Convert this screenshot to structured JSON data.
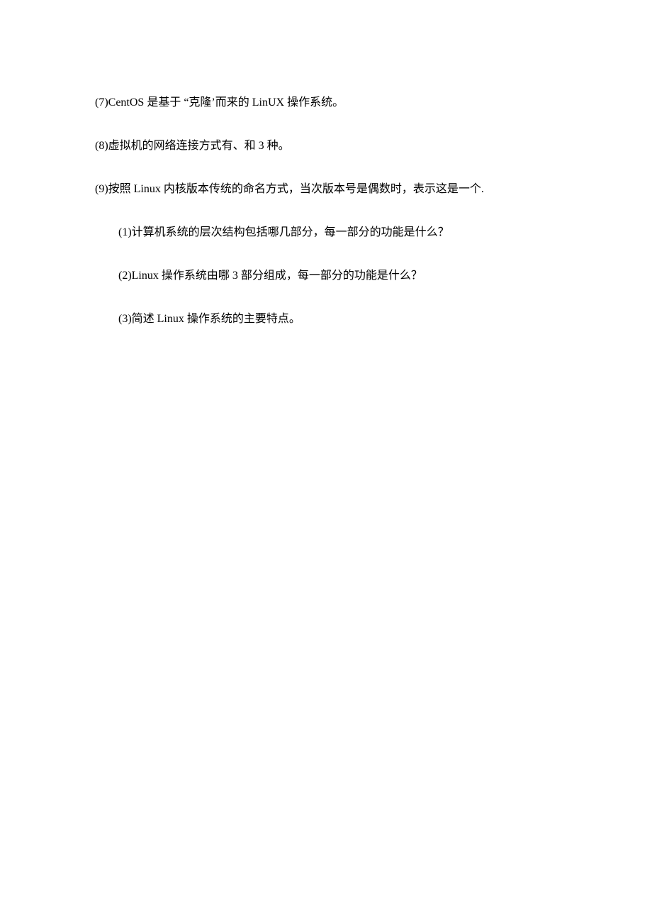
{
  "lines": {
    "q7": "(7)CentOS 是基于 “克隆’而来的 LinUX 操作系统。",
    "q8": "(8)虚拟机的网络连接方式有、和 3 种。",
    "q9": "(9)按照 Linux 内核版本传统的命名方式，当次版本号是偶数时，表示这是一个.",
    "sub1": "(1)计算机系统的层次结构包括哪几部分，每一部分的功能是什么？",
    "sub2": "(2)Linux 操作系统由哪 3 部分组成，每一部分的功能是什么？",
    "sub3": "(3)简述 Linux 操作系统的主要特点。"
  }
}
